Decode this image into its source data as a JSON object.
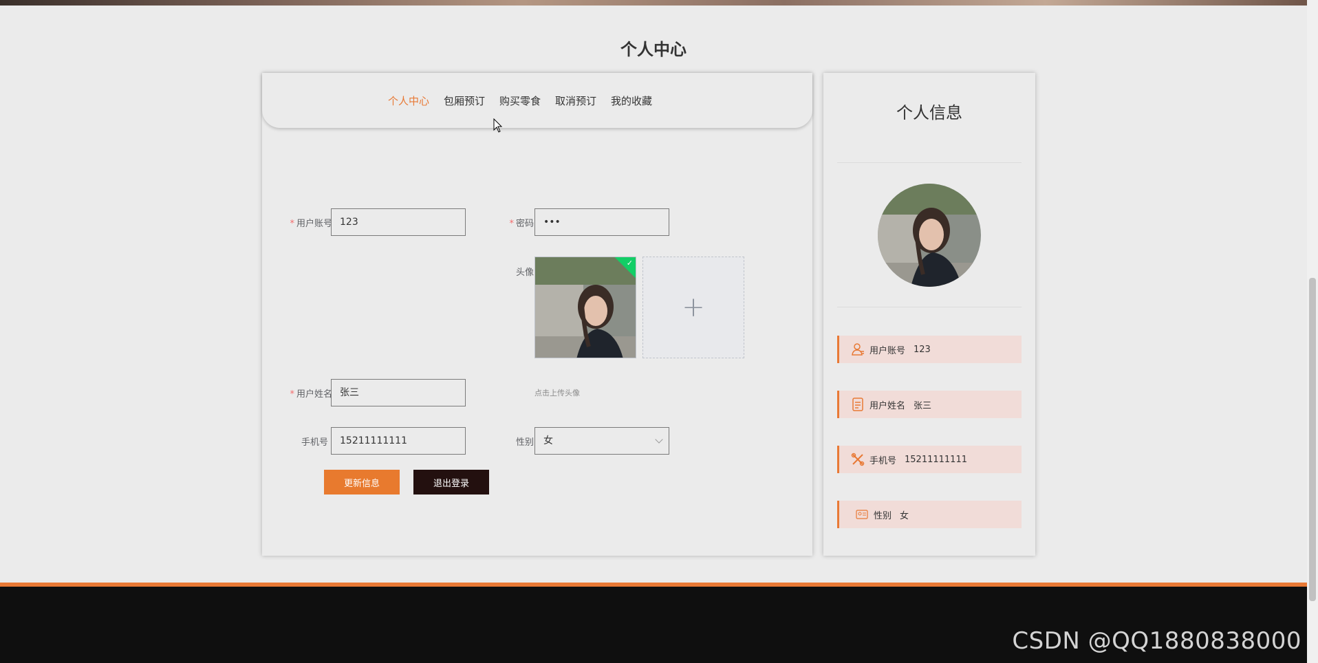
{
  "page": {
    "title": "个人中心"
  },
  "tabs": [
    {
      "label": "个人中心",
      "active": true
    },
    {
      "label": "包厢预订"
    },
    {
      "label": "购买零食"
    },
    {
      "label": "取消预订"
    },
    {
      "label": "我的收藏"
    }
  ],
  "form": {
    "account_label": "用户账号",
    "account_value": "123",
    "password_label": "密码",
    "password_value": "•••",
    "avatar_label": "头像",
    "upload_tip": "点击上传头像",
    "upload_icon": "plus-icon",
    "name_label": "用户姓名",
    "name_value": "张三",
    "phone_label": "手机号",
    "phone_value": "15211111111",
    "gender_label": "性别",
    "gender_value": "女",
    "required_mark": "*"
  },
  "buttons": {
    "update": "更新信息",
    "logout": "退出登录"
  },
  "sidebar": {
    "title": "个人信息",
    "rows": [
      {
        "label": "用户账号",
        "value": "123",
        "icon": "user-icon"
      },
      {
        "label": "用户姓名",
        "value": "张三",
        "icon": "document-icon"
      },
      {
        "label": "手机号",
        "value": "15211111111",
        "icon": "tools-icon"
      },
      {
        "label": "性别",
        "value": "女",
        "icon": "id-card-icon"
      }
    ]
  },
  "watermark": "CSDN @QQ1880838000",
  "colors": {
    "accent": "#e87935",
    "button_orange": "#e87a2e",
    "button_dark": "#23100f",
    "info_row_bg": "#f1dcd8",
    "footer_bg": "#0f0f0f",
    "page_bg": "#ebebeb"
  }
}
